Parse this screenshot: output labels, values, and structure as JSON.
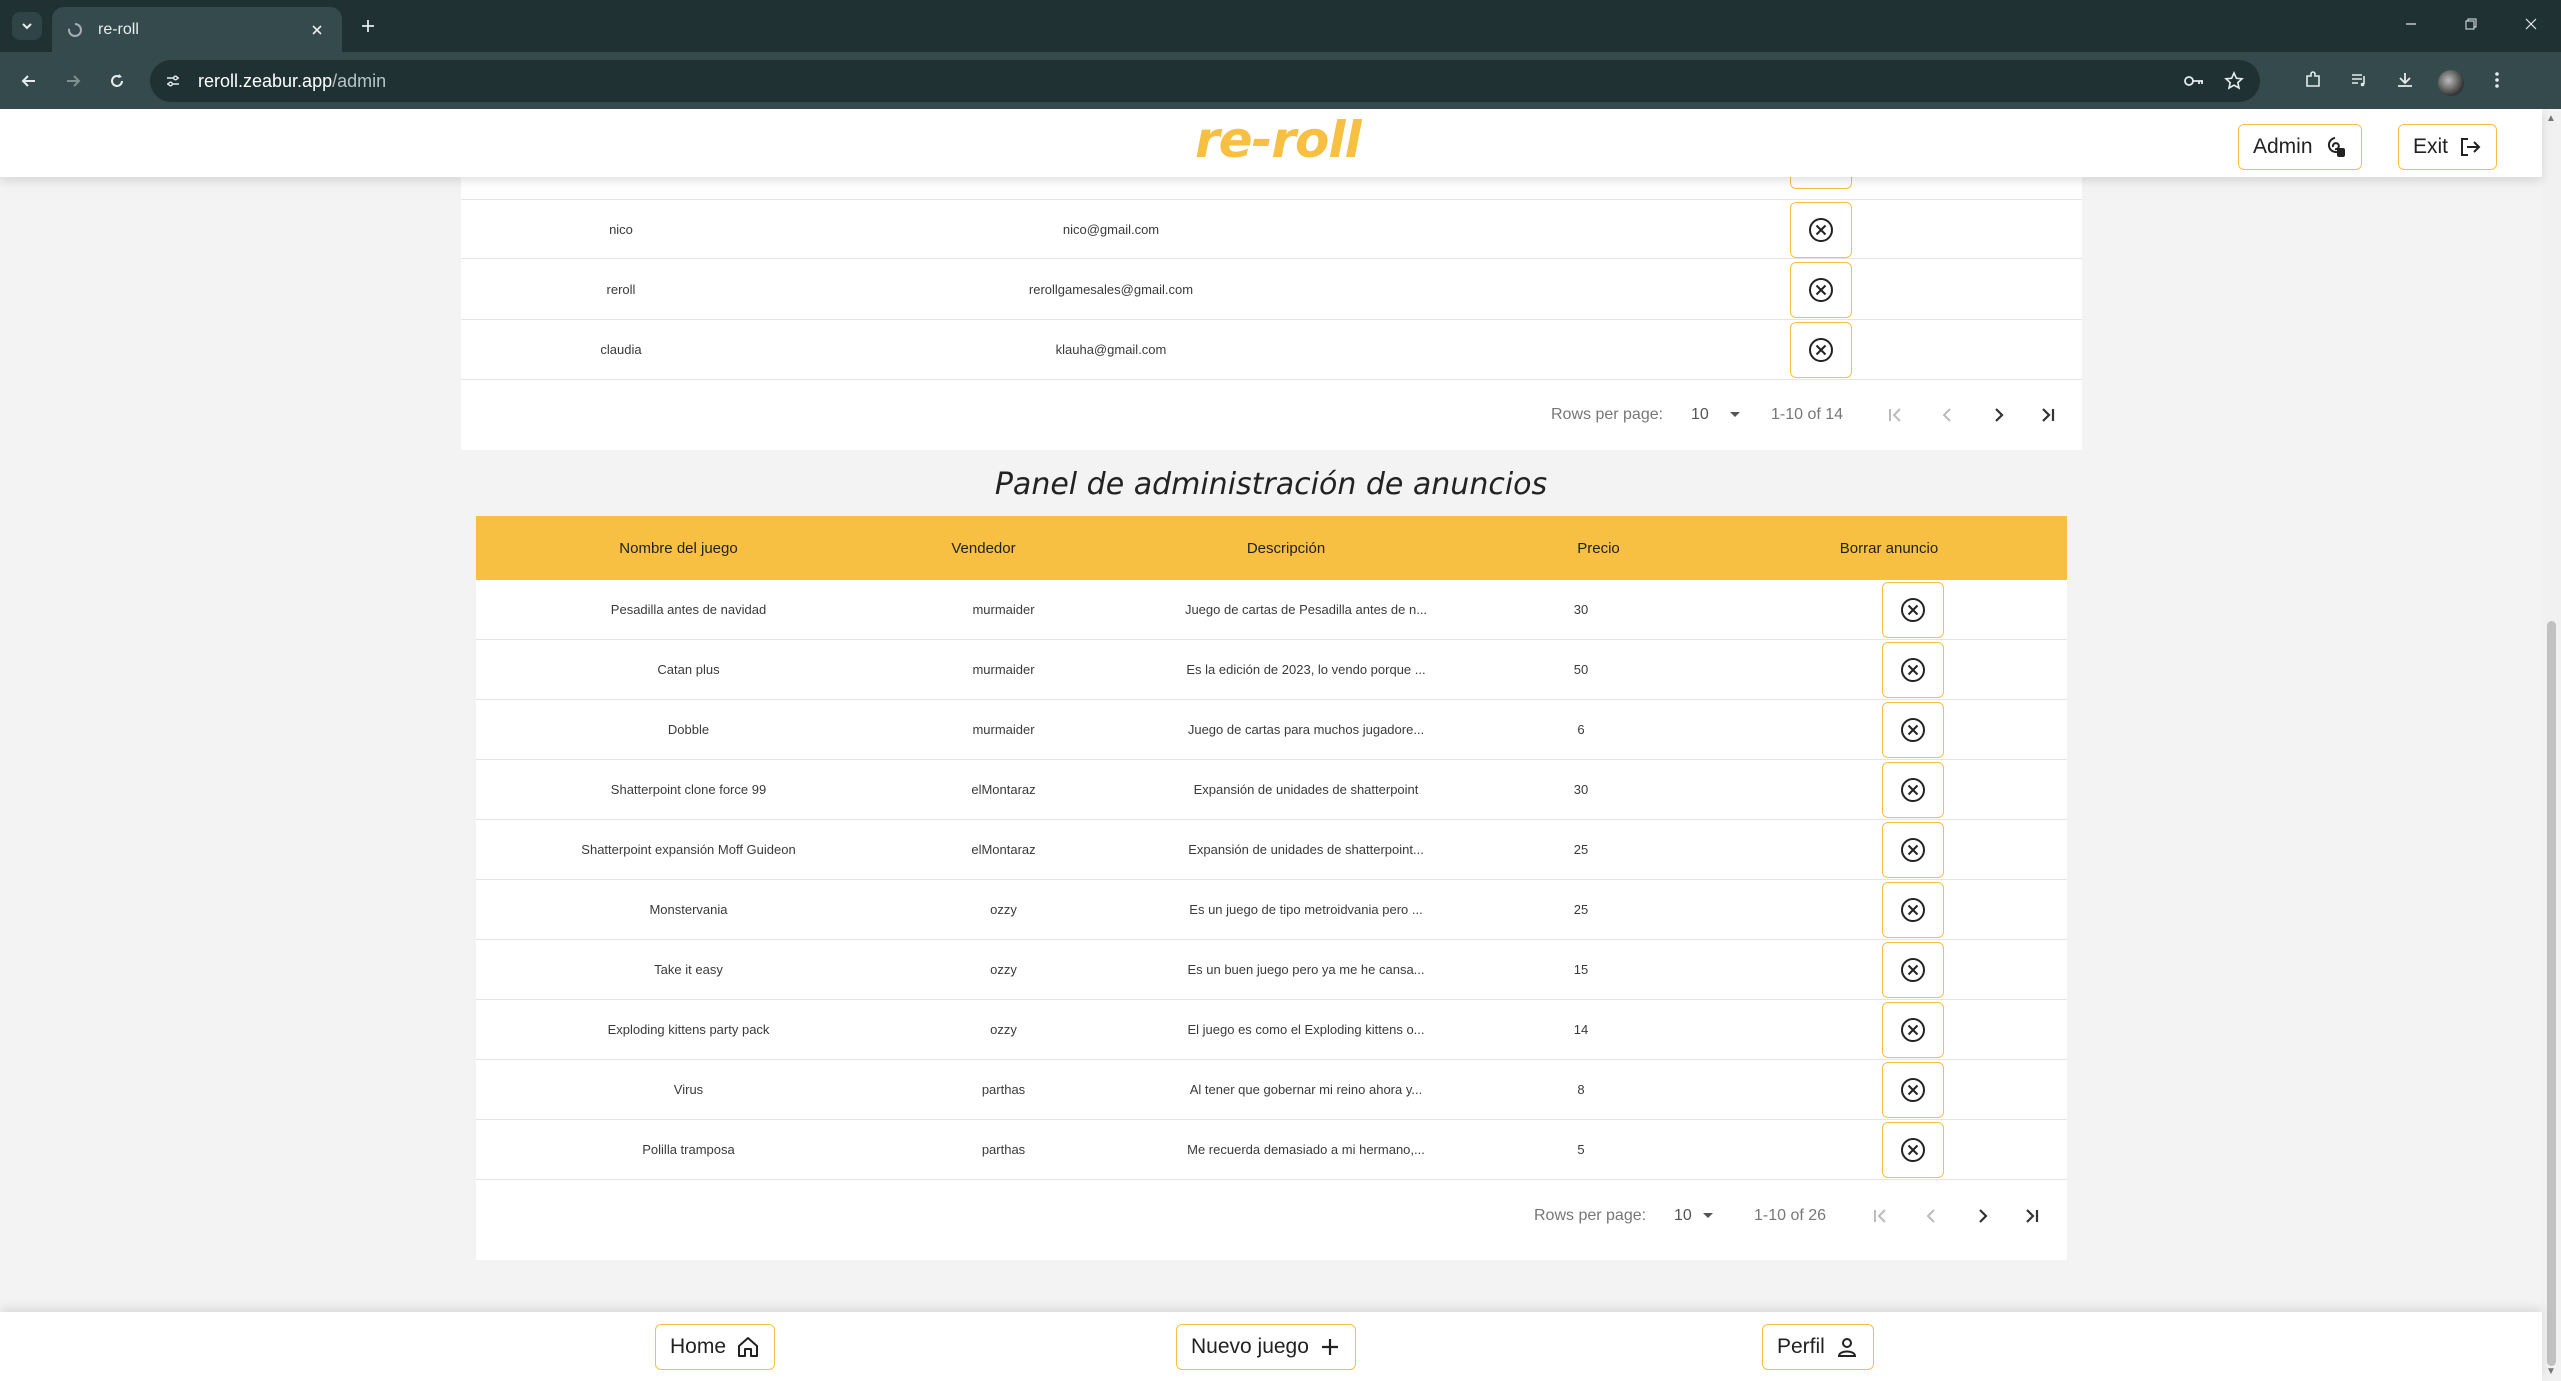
{
  "browser": {
    "tab_title": "re-roll",
    "url_host": "reroll.zeabur.app",
    "url_path": "/admin"
  },
  "header": {
    "logo": "re-roll",
    "admin_label": "Admin",
    "exit_label": "Exit"
  },
  "users_table": {
    "rows": [
      {
        "username": "nico",
        "email": "nico@gmail.com"
      },
      {
        "username": "reroll",
        "email": "rerollgamesales@gmail.com"
      },
      {
        "username": "claudia",
        "email": "klauha@gmail.com"
      }
    ],
    "pagination": {
      "rows_per_page_label": "Rows per page:",
      "rows_per_page": "10",
      "range": "1-10 of 14"
    }
  },
  "ads_panel": {
    "title": "Panel de administración de anuncios",
    "columns": [
      "Nombre del juego",
      "Vendedor",
      "Descripción",
      "Precio",
      "Borrar anuncio"
    ],
    "rows": [
      {
        "name": "Pesadilla antes de navidad",
        "seller": "murmaider",
        "desc": "Juego de cartas de Pesadilla antes de n...",
        "price": "30"
      },
      {
        "name": "Catan plus",
        "seller": "murmaider",
        "desc": "Es la edición de 2023, lo vendo porque ...",
        "price": "50"
      },
      {
        "name": "Dobble",
        "seller": "murmaider",
        "desc": "Juego de cartas para muchos jugadore...",
        "price": "6"
      },
      {
        "name": "Shatterpoint clone force 99",
        "seller": "elMontaraz",
        "desc": "Expansión de unidades de shatterpoint",
        "price": "30"
      },
      {
        "name": "Shatterpoint expansión Moff Guideon",
        "seller": "elMontaraz",
        "desc": "Expansión de unidades de shatterpoint...",
        "price": "25"
      },
      {
        "name": "Monstervania",
        "seller": "ozzy",
        "desc": "Es un juego de tipo metroidvania pero ...",
        "price": "25"
      },
      {
        "name": "Take it easy",
        "seller": "ozzy",
        "desc": "Es un buen juego pero ya me he cansa...",
        "price": "15"
      },
      {
        "name": "Exploding kittens party pack",
        "seller": "ozzy",
        "desc": "El juego es como el Exploding kittens o...",
        "price": "14"
      },
      {
        "name": "Virus",
        "seller": "parthas",
        "desc": "Al tener que gobernar mi reino ahora y...",
        "price": "8"
      },
      {
        "name": "Polilla tramposa",
        "seller": "parthas",
        "desc": "Me recuerda demasiado a mi hermano,...",
        "price": "5"
      }
    ],
    "pagination": {
      "rows_per_page_label": "Rows per page:",
      "rows_per_page": "10",
      "range": "1-10 of 26"
    }
  },
  "bottom_nav": {
    "home": "Home",
    "new_game": "Nuevo juego",
    "profile": "Perfil"
  },
  "colors": {
    "accent": "#f7c043",
    "chrome_dark": "#1f3133",
    "chrome_mid": "#354a4c"
  }
}
